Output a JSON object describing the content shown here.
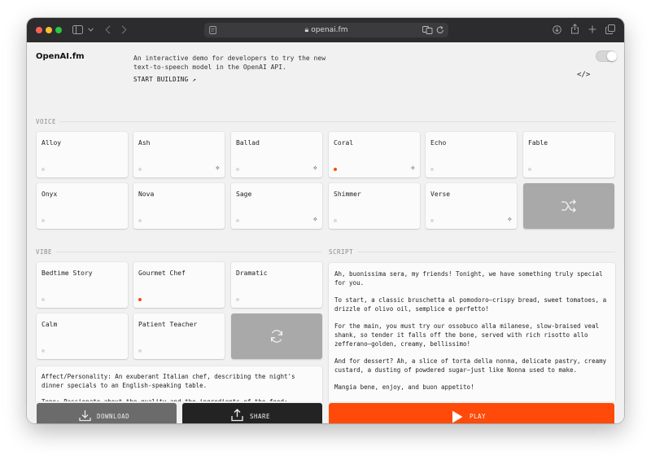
{
  "browser": {
    "url": "openai.fm",
    "colors": {
      "close": "#ff5f57",
      "minimize": "#febc2e",
      "maximize": "#28c840"
    },
    "icons": [
      "sidebar-icon",
      "chevron-down-icon",
      "back-icon",
      "forward-icon",
      "page-icon",
      "lock-icon",
      "translate-icon",
      "reload-icon",
      "downloads-icon",
      "share-icon",
      "new-tab-icon",
      "tabs-icon"
    ]
  },
  "header": {
    "brand": "OpenAI.fm",
    "tagline": "An interactive demo for developers to try the new text-to-speech model in the OpenAI API.",
    "start_building": "START BUILDING ↗",
    "code_icon_glyph": "</>",
    "dark_mode_toggle": false
  },
  "voice": {
    "label": "VOICE",
    "items": [
      {
        "name": "Alloy",
        "selected": false,
        "new": false
      },
      {
        "name": "Ash",
        "selected": false,
        "new": true
      },
      {
        "name": "Ballad",
        "selected": false,
        "new": true
      },
      {
        "name": "Coral",
        "selected": true,
        "new": true
      },
      {
        "name": "Echo",
        "selected": false,
        "new": false
      },
      {
        "name": "Fable",
        "selected": false,
        "new": false
      },
      {
        "name": "Onyx",
        "selected": false,
        "new": false
      },
      {
        "name": "Nova",
        "selected": false,
        "new": false
      },
      {
        "name": "Sage",
        "selected": false,
        "new": true
      },
      {
        "name": "Shimmer",
        "selected": false,
        "new": false
      },
      {
        "name": "Verse",
        "selected": false,
        "new": true
      }
    ],
    "shuffle_icon": "shuffle-icon"
  },
  "vibe": {
    "label": "VIBE",
    "items": [
      {
        "name": "Bedtime Story",
        "selected": false
      },
      {
        "name": "Gourmet Chef",
        "selected": true
      },
      {
        "name": "Dramatic",
        "selected": false
      },
      {
        "name": "Calm",
        "selected": false
      },
      {
        "name": "Patient Teacher",
        "selected": false
      }
    ],
    "refresh_icon": "refresh-icon",
    "description": [
      "Affect/Personality: An exuberant Italian chef, describing the night's dinner specials to an English-speaking table.",
      "Tone: Passionate about the quality and the ingredients of the food;"
    ]
  },
  "script": {
    "label": "SCRIPT",
    "paragraphs": [
      "Ah, buonissima sera, my friends! Tonight, we have something truly special for you.",
      "To start, a classic bruschetta al pomodoro—crispy bread, sweet tomatoes, a drizzle of olivo oil, semplice e perfetto!",
      "For the main, you must try our ossobuco alla milanese, slow-braised veal shank, so tender it falls off the bone, served with rich risotto allo zefferano—golden, creamy, bellissimo!",
      "And for dessert? Ah, a slice of torta della nonna, delicate pastry, creamy custard, a dusting of powdered sugar—just like Nonna used to make.",
      "Mangia bene, enjoy, and buon appetito!"
    ]
  },
  "actions": {
    "download": "DOWNLOAD",
    "share": "SHARE",
    "play": "PLAY",
    "colors": {
      "download": "#6b6b6b",
      "share": "#232323",
      "play": "#ff4a0a"
    }
  }
}
